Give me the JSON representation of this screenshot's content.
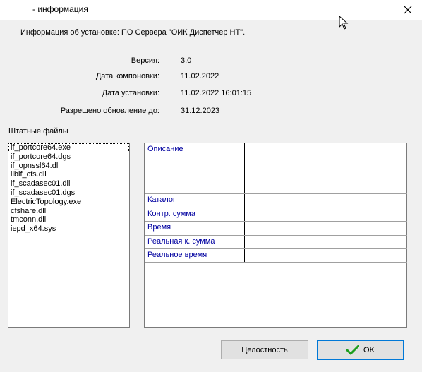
{
  "window": {
    "title": "- информация"
  },
  "header": {
    "text": "Информация об установке:  ПО Сервера \"ОИК Диспетчер НТ\"."
  },
  "info": [
    {
      "label": "Версия:",
      "value": "3.0"
    },
    {
      "label": "Дата компоновки:",
      "value": "11.02.2022"
    },
    {
      "label": "Дата установки:",
      "value": "11.02.2022 16:01:15"
    },
    {
      "label": "Разрешено обновление до:",
      "value": "31.12.2023"
    }
  ],
  "files": {
    "label": "Штатные файлы",
    "items": [
      "if_portcore64.exe",
      "if_portcore64.dgs",
      "if_opnssl64.dll",
      "libif_cfs.dll",
      "if_scadasec01.dll",
      "if_scadasec01.dgs",
      "ElectricTopology.exe",
      "cfshare.dll",
      "tmconn.dll",
      "iepd_x64.sys"
    ]
  },
  "details": {
    "description_label": "Описание",
    "description_value": "",
    "catalog_label": "Каталог",
    "catalog_value": "",
    "checksum_label": "Контр. сумма",
    "checksum_value": "",
    "time_label": "Время",
    "time_value": "",
    "real_checksum_label": "Реальная к. сумма",
    "real_checksum_value": "",
    "real_time_label": "Реальное время",
    "real_time_value": ""
  },
  "buttons": {
    "integrity": "Целостность",
    "ok": "OK"
  },
  "icons": {
    "close": "close-icon",
    "check": "check-icon",
    "cursor": "cursor-icon"
  },
  "colors": {
    "accent": "#0078d7",
    "key_text": "#0000a0",
    "check_green": "#1f9e1f"
  }
}
